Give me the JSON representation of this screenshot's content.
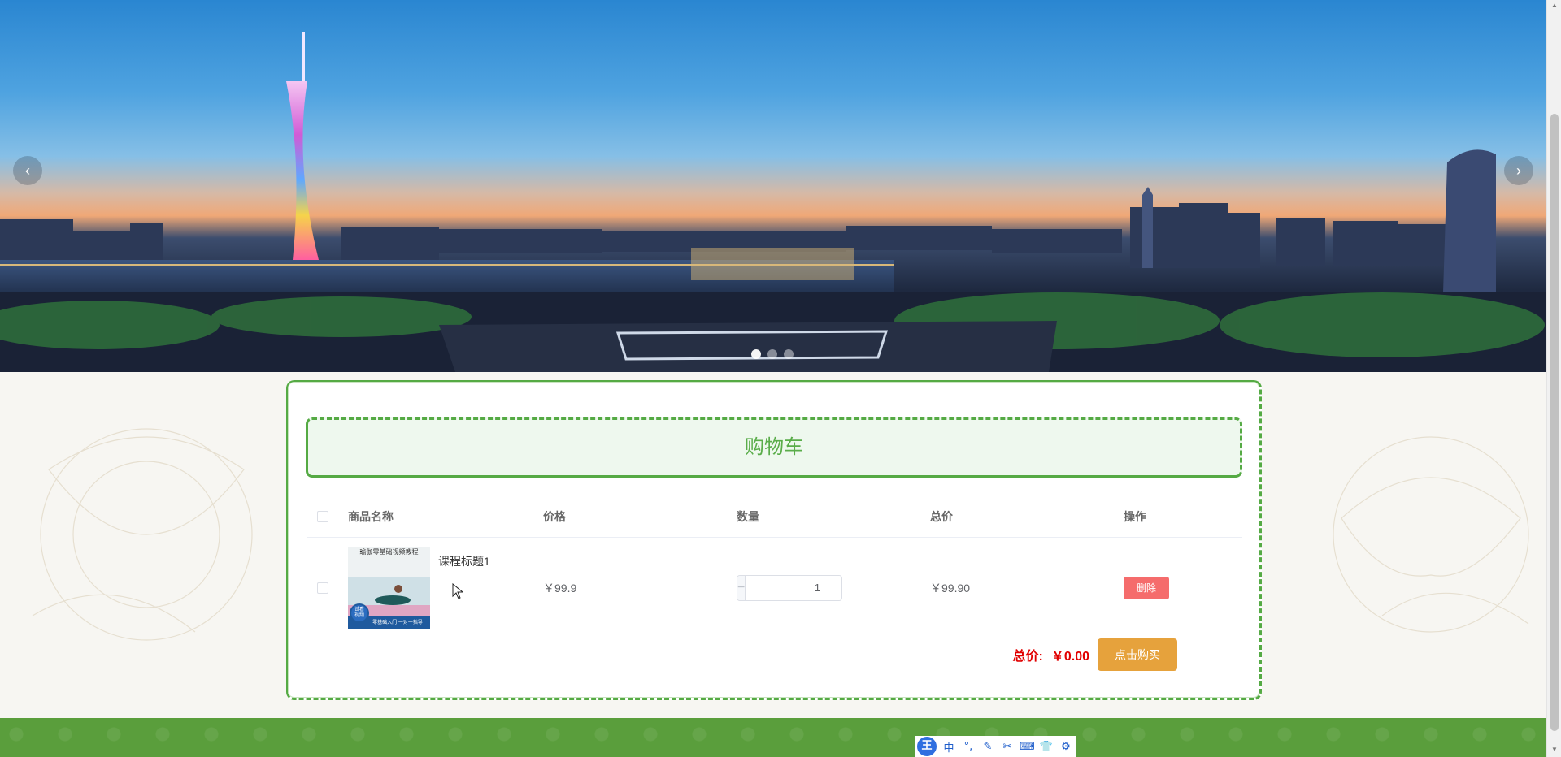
{
  "banner": {
    "prev_label": "‹",
    "next_label": "›",
    "slide_count": 3,
    "active_slide": 1
  },
  "cart": {
    "title": "购物车",
    "columns": {
      "name": "商品名称",
      "price": "价格",
      "quantity": "数量",
      "total": "总价",
      "action": "操作"
    },
    "items": [
      {
        "thumb_lines": [
          "瑜伽零基础视频教程",
          "零基础入门 一对一指导"
        ],
        "thumb_badge": "试看\n视频",
        "title": "课程标题1",
        "price": "￥99.9",
        "quantity": "1",
        "total": "￥99.90",
        "delete_label": "删除"
      }
    ],
    "grand_total_label": "总价:",
    "grand_total_value": "￥0.00",
    "buy_label": "点击购买"
  },
  "ime": {
    "logo": "王",
    "items": [
      "中",
      "°,",
      "✎",
      "✂",
      "⌨",
      "👕",
      "⚙"
    ]
  },
  "colors": {
    "accent_green": "#55aa44",
    "title_green": "#5aad4a",
    "delete_red": "#f56c6c",
    "buy_orange": "#e6a23c",
    "total_red": "#e10000",
    "footer_green": "#5a9e3c"
  },
  "icons": {
    "prev": "chevron-left-icon",
    "next": "chevron-right-icon",
    "minus": "minus-icon",
    "plus": "plus-icon"
  }
}
